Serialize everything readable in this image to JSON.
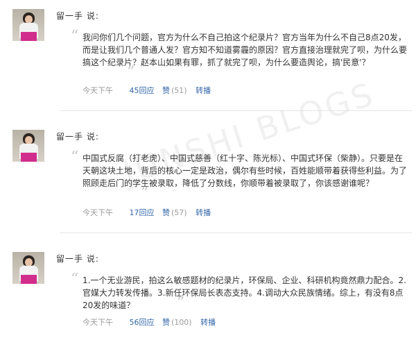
{
  "comments": [
    {
      "author": "留一手",
      "says": "说:",
      "text": "我问你们几个问题，官方为什么不自己拍这个纪录片？官方当年为什么不自己8点20发，而是让我们几个普通人发？官方知不知道雾霾的原因？官方直接治理就完了呗，为什么要搞这个纪录片？赵本山如果有罪，抓了就完了呗，为什么要造舆论，搞'民意'？",
      "time": "今天下午",
      "replies": "45回应",
      "like": "赞",
      "like_count": "(51)",
      "share": "转播"
    },
    {
      "author": "留一手",
      "says": "说:",
      "text": "中国式反腐（打老虎）、中国式慈善（红十字、陈光标）、中国式环保（柴静）。只要是在天朝这块土地，背后的核心一定是政治，偶尔有些时候，百姓能顺带着获得些利益。为了照顾走后门的学生被录取，降低了分数线，你顺带着被录取了，你该感谢谁呢？",
      "time": "今天下午",
      "replies": "17回应",
      "like": "赞",
      "like_count": "(57)",
      "share": "转播"
    },
    {
      "author": "留一手",
      "says": "说:",
      "text": "1.一个无业游民，拍这么敏感题材的纪录片，环保局、企业、科研机构竟然鼎力配合。2.官媒大力转发传播。3.新任环保局长表态支持。4.调动大众民族情绪。综上，有没有8点20发的味道？",
      "time": "今天下午",
      "replies": "56回应",
      "like": "赞",
      "like_count": "(100)",
      "share": "转播"
    }
  ],
  "watermark": "JUNSHI BLOGS"
}
